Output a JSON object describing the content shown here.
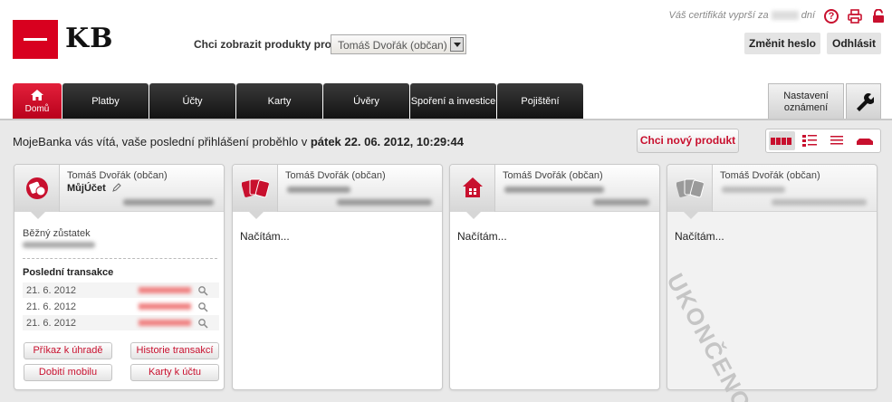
{
  "header": {
    "logo_text": "KB",
    "products_label": "Chci zobrazit produkty pro",
    "products_select": "Tomáš Dvořák (občan)",
    "cert_prefix": "Váš certifikát vyprší za",
    "cert_suffix": "dní",
    "change_password": "Změnit heslo",
    "logout": "Odhlásit"
  },
  "nav": {
    "tabs": [
      {
        "label": "Domů"
      },
      {
        "label": "Platby"
      },
      {
        "label": "Účty"
      },
      {
        "label": "Karty"
      },
      {
        "label": "Úvěry"
      },
      {
        "label": "Spoření a investice"
      },
      {
        "label": "Pojištění"
      }
    ],
    "settings": "Nastavení oznámení"
  },
  "main": {
    "welcome_prefix": "MojeBanka vás vítá, vaše poslední přihlášení proběhlo v",
    "welcome_date": "pátek 22. 06. 2012, 10:29:44",
    "new_product": "Chci nový produkt"
  },
  "cards": [
    {
      "owner": "Tomáš Dvořák (občan)",
      "account": "MůjÚčet",
      "balance_label": "Běžný zůstatek",
      "transactions_title": "Poslední transakce",
      "transactions": [
        {
          "date": "21. 6. 2012"
        },
        {
          "date": "21. 6. 2012"
        },
        {
          "date": "21. 6. 2012"
        }
      ],
      "buttons": [
        "Příkaz k úhradě",
        "Historie transakcí",
        "Dobití mobilu",
        "Karty k účtu"
      ]
    },
    {
      "owner": "Tomáš Dvořák (občan)",
      "loading": "Načítám..."
    },
    {
      "owner": "Tomáš Dvořák (občan)",
      "loading": "Načítám..."
    },
    {
      "owner": "Tomáš Dvořák (občan)",
      "loading": "Načítám...",
      "stamp": "UKONČENO"
    }
  ],
  "colors": {
    "brand": "#d8001f",
    "nav_dark": "#1a1a1a",
    "link_red": "#c8102e"
  }
}
